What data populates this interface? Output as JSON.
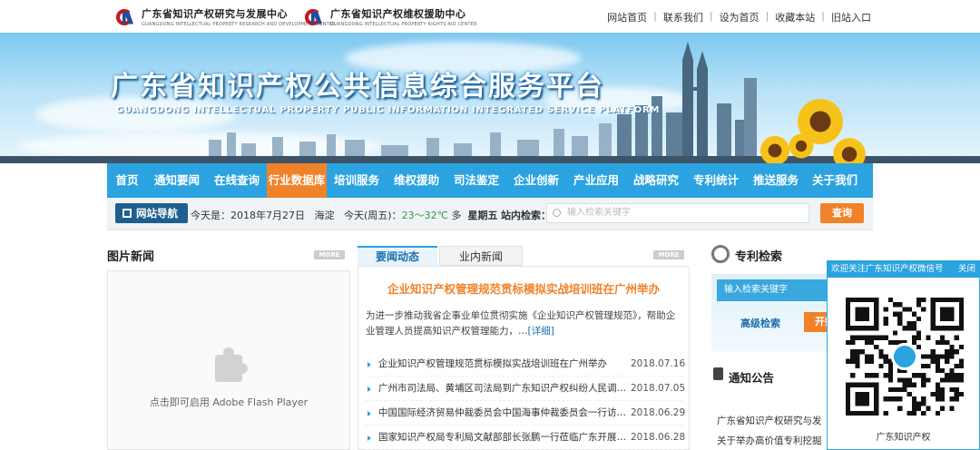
{
  "header": {
    "logo1": {
      "cn": "广东省知识产权研究与发展中心",
      "en": "GUANGDONG INTELLECTUAL PROPERTY RESEARCH AND DEVELOPMENT CENTER"
    },
    "logo2": {
      "cn": "广东省知识产权维权援助中心",
      "en": "GUANGDONG INTELLECTUAL PROPERTY RIGHTS AID CENTER"
    },
    "links": [
      "网站首页",
      "联系我们",
      "设为首页",
      "收藏本站",
      "旧站入口"
    ],
    "separator": "|"
  },
  "banner": {
    "title": "广东省知识产权公共信息综合服务平台",
    "subtitle": "GUANGDONG INTELLECTUAL PROPERTY PUBLIC INFORMATION INTEGRATED SERVICE PLATFORM"
  },
  "nav": {
    "active_index": 4,
    "tabs": [
      "首页",
      "通知要闻",
      "在线查询",
      "行业数据库",
      "培训服务",
      "维权援助",
      "司法鉴定",
      "企业创新",
      "产业应用",
      "战略研究",
      "专利统计",
      "推送服务",
      "关于我们"
    ]
  },
  "infobar": {
    "nav_guide": "网站导航",
    "date_prefix": "今天是：",
    "date": "2018年7月27日",
    "city": "海淀",
    "today_label": "今天(周五)：",
    "temp": "23～32℃",
    "weather": "多",
    "weekday": "星期五",
    "search_label": "站内检索：",
    "search_placeholder": "输入检索关键字",
    "search_button": "查询"
  },
  "picture_news": {
    "title": "图片新闻",
    "more": "MORE",
    "flash_msg": "点击即可启用 Adobe Flash Player"
  },
  "news": {
    "tab_active": "要闻动态",
    "tab_other": "业内新闻",
    "more": "MORE",
    "headline": "企业知识产权管理规范贯标模拟实战培训班在广州举办",
    "summary": "为进一步推动我省企事业单位贯彻实施《企业知识产权管理规范》，帮助企业管理人员提高知识产权管理能力，…",
    "detail": "[详细]",
    "items": [
      {
        "title": "企业知识产权管理规范贯标模拟实战培训班在广州举办",
        "date": "2018.07.16"
      },
      {
        "title": "广州市司法局、黄埔区司法局到广东知识产权纠纷人民调解…",
        "date": "2018.07.05"
      },
      {
        "title": "中国国际经济贸易仲裁委员会中国海事仲裁委员会一行访问…",
        "date": "2018.06.29"
      },
      {
        "title": "国家知识产权局专利局文献部部长张鹏一行莅临广东开展工…",
        "date": "2018.06.28"
      }
    ]
  },
  "patent": {
    "title": "专利检索",
    "placeholder": "输入检索关键字",
    "advanced": "高级检索",
    "button": "开始"
  },
  "notice": {
    "title": "通知公告",
    "lines": [
      "广东省知识产权研究与发",
      "关于举办高价值专利挖掘"
    ]
  },
  "qr_popup": {
    "header": "欢迎关注广东知识产权微信号",
    "close": "关闭",
    "caption": "广东知识产权"
  },
  "colors": {
    "accent_blue": "#2aa3e0",
    "accent_orange": "#f0822a",
    "nav_dark": "#1e5f8f"
  }
}
